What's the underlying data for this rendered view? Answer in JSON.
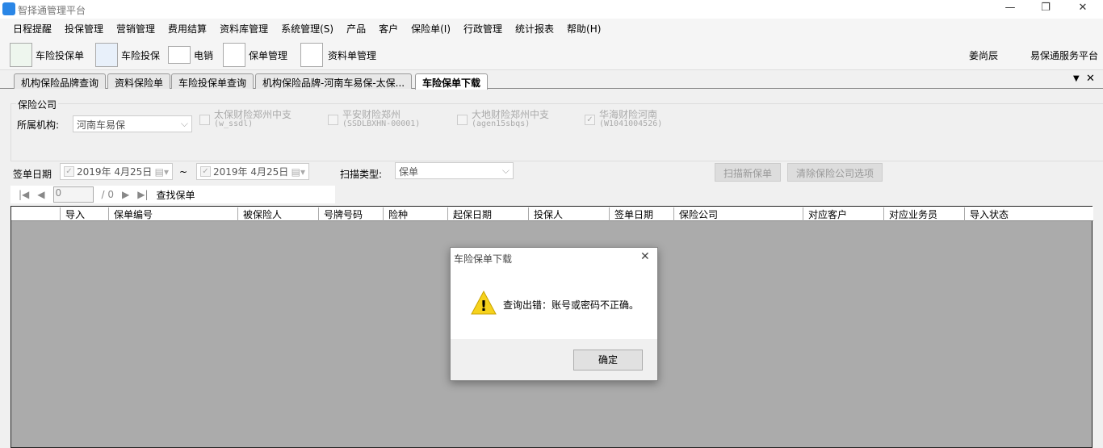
{
  "window": {
    "title": "智择通管理平台"
  },
  "menu": [
    "日程提醒",
    "投保管理",
    "营销管理",
    "费用结算",
    "资料库管理",
    "系统管理(S)",
    "产品",
    "客户",
    "保险单(I)",
    "行政管理",
    "统计报表",
    "帮助(H)"
  ],
  "toolbar": {
    "items": [
      "车险投保单",
      "车险投保",
      "电销",
      "保单管理",
      "资料单管理"
    ],
    "user": "姜尚辰",
    "platform": "易保通服务平台"
  },
  "tabs": [
    "机构保险品牌查询",
    "资料保险单",
    "车险投保单查询",
    "机构保险品牌-河南车易保-太保...",
    "车险保单下载"
  ],
  "form": {
    "group_label": "保险公司",
    "org_label": "所属机构:",
    "org_value": "河南车易保",
    "companies": [
      {
        "name": "太保财险郑州中支",
        "code": "(w_ssdl)",
        "checked": false
      },
      {
        "name": "平安财险郑州",
        "code": "(SSDLBXHN-00001)",
        "checked": false
      },
      {
        "name": "大地财险郑州中支",
        "code": "(agen15sbqs)",
        "checked": false
      },
      {
        "name": "华海财险河南",
        "code": "(W1041004526)",
        "checked": true
      }
    ],
    "date_label": "签单日期",
    "date_from": "2019年  4月25日",
    "tilde": "~",
    "date_to": "2019年  4月25日",
    "scan_label": "扫描类型:",
    "scan_value": "保单",
    "scan_button": "扫描新保单",
    "clear_button": "清除保险公司选项"
  },
  "nav": {
    "page": "0",
    "total": "/ 0",
    "find": "查找保单"
  },
  "grid": {
    "columns": [
      "导入",
      "保单编号",
      "被保险人",
      "号牌号码",
      "险种",
      "起保日期",
      "投保人",
      "签单日期",
      "保险公司",
      "对应客户",
      "对应业务员",
      "导入状态"
    ]
  },
  "dialog": {
    "title": "车险保单下载",
    "message": "查询出错：账号或密码不正确。",
    "ok": "确定"
  }
}
